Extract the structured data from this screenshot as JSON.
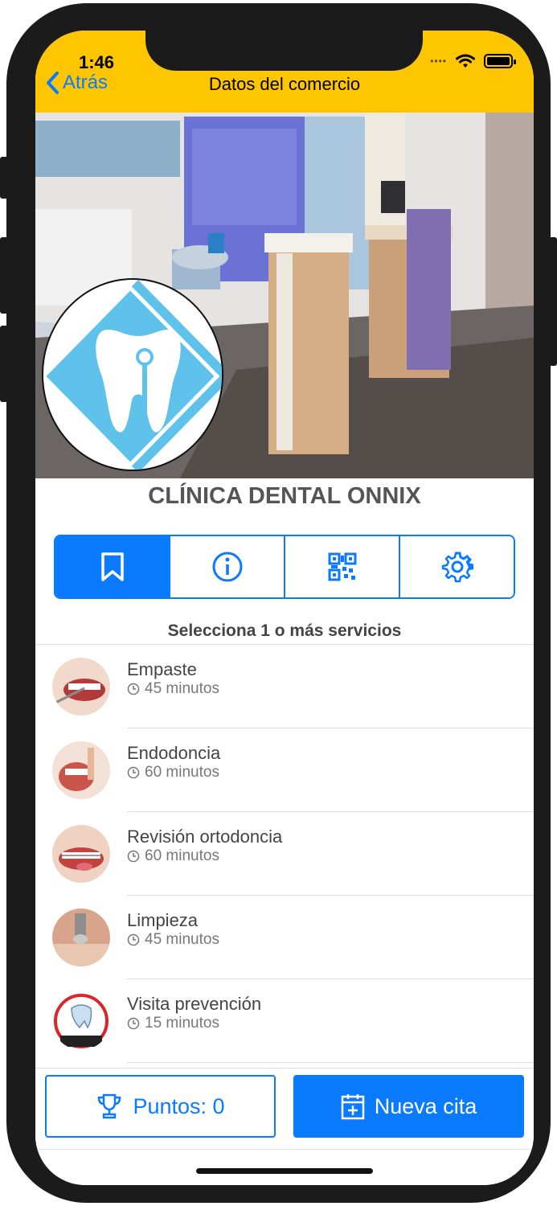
{
  "status_bar": {
    "time": "1:46"
  },
  "nav": {
    "back_label": "Atrás",
    "title": "Datos del comercio"
  },
  "business": {
    "name": "CLÍNICA DENTAL ONNIX"
  },
  "tabs": [
    {
      "icon": "bookmark-icon",
      "active": true
    },
    {
      "icon": "info-icon",
      "active": false
    },
    {
      "icon": "qr-code-icon",
      "active": false
    },
    {
      "icon": "gear-icon",
      "active": false
    }
  ],
  "services_section": {
    "title": "Selecciona 1 o más servicios",
    "items": [
      {
        "name": "Empaste",
        "duration": "45 minutos"
      },
      {
        "name": "Endodoncia",
        "duration": "60 minutos"
      },
      {
        "name": "Revisión ortodoncia",
        "duration": "60 minutos"
      },
      {
        "name": "Limpieza",
        "duration": "45 minutos"
      },
      {
        "name": "Visita prevención",
        "duration": "15 minutos"
      }
    ]
  },
  "footer": {
    "points_label": "Puntos: 0",
    "new_appointment_label": "Nueva cita"
  },
  "colors": {
    "header": "#fec600",
    "accent": "#0a7aff",
    "logo": "#5ec2ea"
  }
}
